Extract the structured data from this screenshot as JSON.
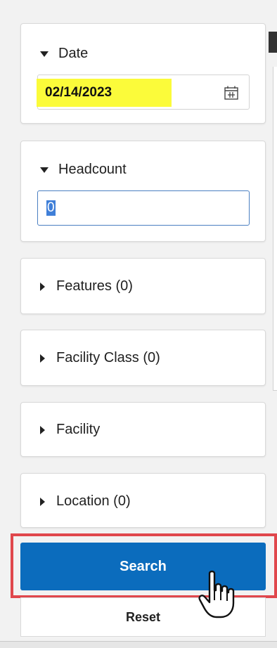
{
  "filters": {
    "date": {
      "label": "Date",
      "value": "02/14/2023"
    },
    "headcount": {
      "label": "Headcount",
      "value": "0"
    },
    "features": {
      "label": "Features (0)"
    },
    "facility_class": {
      "label": "Facility Class (0)"
    },
    "facility": {
      "label": "Facility"
    },
    "location": {
      "label": "Location (0)"
    }
  },
  "actions": {
    "search_label": "Search",
    "reset_label": "Reset"
  },
  "colors": {
    "primary": "#0b6cbd",
    "highlight": "#fbfb3a",
    "annotation_outline": "#e0474c"
  },
  "icons": {
    "expanded": "triangle-down-icon",
    "collapsed": "triangle-right-icon",
    "calendar": "calendar-icon",
    "cursor": "hand-pointer-icon"
  }
}
